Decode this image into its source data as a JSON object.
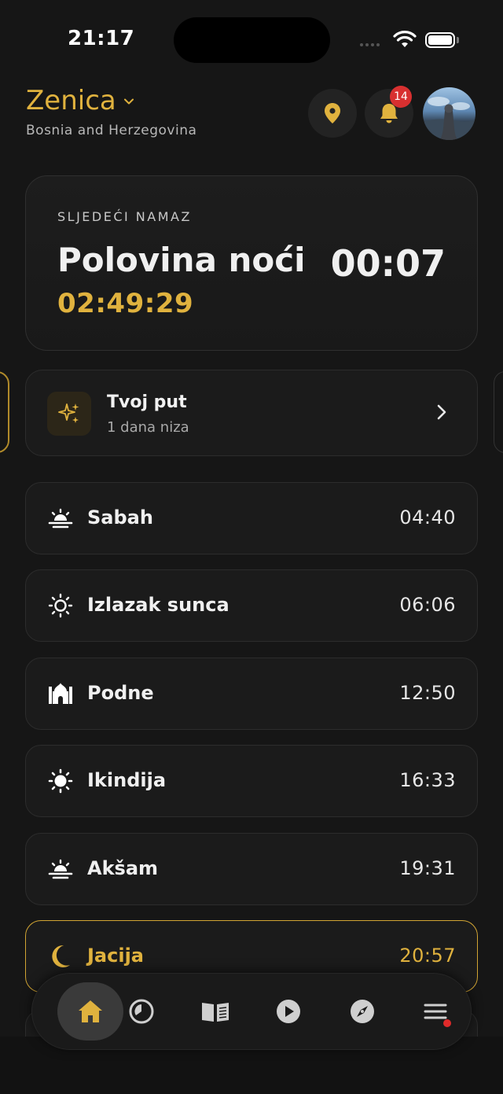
{
  "status_bar": {
    "time": "21:17"
  },
  "header": {
    "city": "Zenica",
    "country": "Bosnia and Herzegovina",
    "notifications_count": "14"
  },
  "next_prayer": {
    "label": "SLJEDEĆI NAMAZ",
    "name": "Polovina noći",
    "time": "00:07",
    "countdown": "02:49:29"
  },
  "journey": {
    "title": "Tvoj put",
    "subtitle": "1 dana niza"
  },
  "prayers": [
    {
      "name": "Sabah",
      "time": "04:40",
      "icon": "sunrise-icon"
    },
    {
      "name": "Izlazak sunca",
      "time": "06:06",
      "icon": "sun-outline-icon"
    },
    {
      "name": "Podne",
      "time": "12:50",
      "icon": "mosque-icon"
    },
    {
      "name": "Ikindija",
      "time": "16:33",
      "icon": "sun-icon"
    },
    {
      "name": "Akšam",
      "time": "19:31",
      "icon": "sunset-icon"
    },
    {
      "name": "Jacija",
      "time": "20:57",
      "icon": "moon-icon",
      "active": true
    }
  ],
  "tabs": [
    {
      "name": "home",
      "icon": "home-icon",
      "active": true
    },
    {
      "name": "clock",
      "icon": "clock-icon"
    },
    {
      "name": "quran",
      "icon": "book-icon"
    },
    {
      "name": "media",
      "icon": "play-icon"
    },
    {
      "name": "qibla",
      "icon": "compass-icon"
    },
    {
      "name": "menu",
      "icon": "menu-icon"
    }
  ],
  "colors": {
    "accent": "#e0b23e",
    "background": "#161616",
    "card": "#1b1b1b",
    "badge": "#d83030"
  }
}
